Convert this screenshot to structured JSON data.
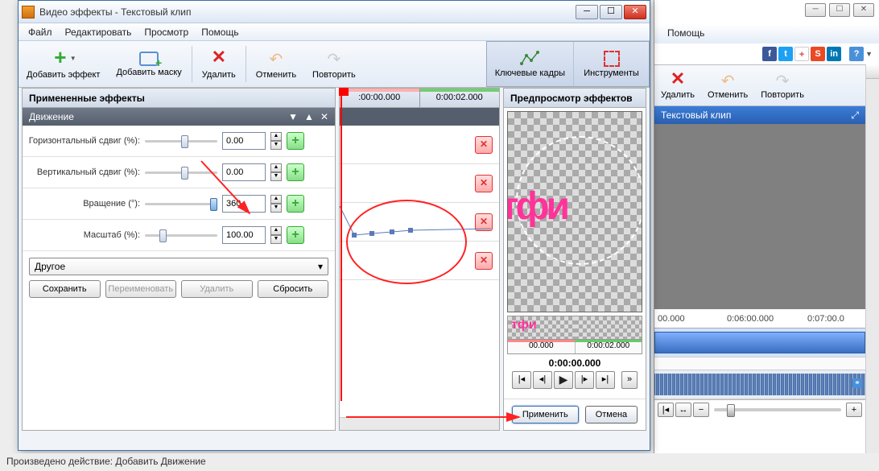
{
  "parent": {
    "menu_help": "Помощь",
    "toolbar": {
      "delete": "Удалить",
      "undo": "Отменить",
      "redo": "Повторить"
    },
    "clip_title": "Текстовый клип",
    "time_ticks": [
      "00.000",
      "0:06:00.000",
      "0:07:00.0"
    ]
  },
  "dialog": {
    "title": "Видео эффекты - Текстовый клип",
    "menu": {
      "file": "Файл",
      "edit": "Редактировать",
      "view": "Просмотр",
      "help": "Помощь"
    },
    "toolbar": {
      "add_effect": "Добавить эффект",
      "add_mask": "Добавить маску",
      "delete": "Удалить",
      "undo": "Отменить",
      "redo": "Повторить",
      "keyframes": "Ключевые кадры",
      "tools": "Инструменты"
    },
    "left": {
      "applied": "Примененные эффекты",
      "effect": "Движение",
      "params": {
        "hshift": {
          "label": "Горизонтальный сдвиг (%):",
          "value": "0.00",
          "thumb_pos": "50%"
        },
        "vshift": {
          "label": "Вертикальный сдвиг (%):",
          "value": "0.00",
          "thumb_pos": "50%"
        },
        "rotate": {
          "label": "Вращение (°):",
          "value": "360",
          "thumb_pos": "100%"
        },
        "scale": {
          "label": "Масштаб (%):",
          "value": "100.00",
          "thumb_pos": "20%"
        }
      },
      "preset": {
        "select": "Другое",
        "save": "Сохранить",
        "rename": "Переименовать",
        "delete": "Удалить",
        "reset": "Сбросить"
      }
    },
    "mid": {
      "t0": ":00:00.000",
      "t1": "0:00:02.000"
    },
    "right": {
      "title": "Предпросмотр эффектов",
      "strip_text": "тфи",
      "preview_text": "тфи",
      "tl0": "00.000",
      "tl1": "0:00:02.000",
      "playtime": "0:00:00.000"
    },
    "buttons": {
      "apply": "Применить",
      "cancel": "Отмена"
    }
  },
  "status": "Произведено действие: Добавить Движение"
}
